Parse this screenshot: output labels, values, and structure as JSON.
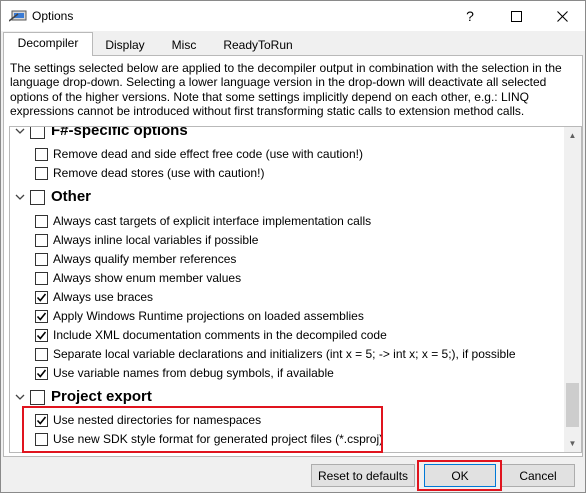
{
  "window": {
    "title": "Options",
    "help_symbol": "?"
  },
  "tabs": [
    {
      "label": "Decompiler",
      "active": true
    },
    {
      "label": "Display",
      "active": false
    },
    {
      "label": "Misc",
      "active": false
    },
    {
      "label": "ReadyToRun",
      "active": false
    }
  ],
  "description": "The settings selected below are applied to the decompiler output in combination with the selection in the language drop-down. Selecting a lower language version in the drop-down will deactivate all selected options of the higher versions. Note that some settings implicitly depend on each other, e.g.: LINQ expressions cannot be introduced without first transforming static calls to extension method calls.",
  "groups": [
    {
      "title": "F#-specific options",
      "checked": false,
      "items": [
        {
          "label": "Remove dead and side effect free code (use with caution!)",
          "checked": false
        },
        {
          "label": "Remove dead stores (use with caution!)",
          "checked": false
        }
      ]
    },
    {
      "title": "Other",
      "checked": false,
      "items": [
        {
          "label": "Always cast targets of explicit interface implementation calls",
          "checked": false
        },
        {
          "label": "Always inline local variables if possible",
          "checked": false
        },
        {
          "label": "Always qualify member references",
          "checked": false
        },
        {
          "label": "Always show enum member values",
          "checked": false
        },
        {
          "label": "Always use braces",
          "checked": true
        },
        {
          "label": "Apply Windows Runtime projections on loaded assemblies",
          "checked": true
        },
        {
          "label": "Include XML documentation comments in the decompiled code",
          "checked": true
        },
        {
          "label": "Separate local variable declarations and initializers (int x = 5; -> int x; x = 5;), if possible",
          "checked": false
        },
        {
          "label": "Use variable names from debug symbols, if available",
          "checked": true
        }
      ]
    },
    {
      "title": "Project export",
      "checked": false,
      "items": [
        {
          "label": "Use nested directories for namespaces",
          "checked": true
        },
        {
          "label": "Use new SDK style format for generated project files (*.csproj)",
          "checked": false
        }
      ]
    }
  ],
  "buttons": {
    "reset": "Reset to defaults",
    "ok": "OK",
    "cancel": "Cancel"
  },
  "colors": {
    "highlight": "#e0141e",
    "default_button_border": "#0078d7"
  }
}
